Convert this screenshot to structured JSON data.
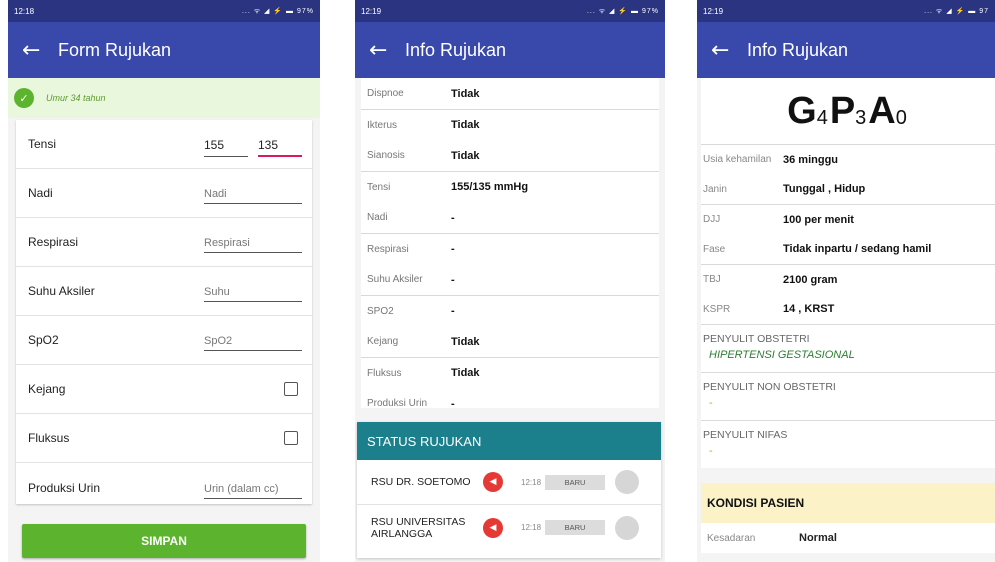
{
  "screen1": {
    "status_time": "12:18",
    "status_icons": "... ᯤ ◢ ⚡ ▬ 97%",
    "title": "Form Rujukan",
    "alert_text": "Umur 34 tahun",
    "fields": [
      {
        "label": "Tensi",
        "type": "pair",
        "value1": "155",
        "value2": "135"
      },
      {
        "label": "Nadi",
        "type": "text",
        "placeholder": "Nadi"
      },
      {
        "label": "Respirasi",
        "type": "text",
        "placeholder": "Respirasi"
      },
      {
        "label": "Suhu Aksiler",
        "type": "text",
        "placeholder": "Suhu"
      },
      {
        "label": "SpO2",
        "type": "text",
        "placeholder": "SpO2"
      },
      {
        "label": "Kejang",
        "type": "check"
      },
      {
        "label": "Fluksus",
        "type": "check"
      },
      {
        "label": "Produksi Urin",
        "type": "text",
        "placeholder": "Urin (dalam cc)"
      }
    ],
    "save_label": "SIMPAN"
  },
  "screen2": {
    "status_time": "12:19",
    "status_icons": "... ᯤ ◢ ⚡ ▬ 97%",
    "title": "Info Rujukan",
    "rows": [
      {
        "label": "Dispnoe",
        "value": "Tidak",
        "sep": false
      },
      {
        "label": "Ikterus",
        "value": "Tidak",
        "sep": true
      },
      {
        "label": "Sianosis",
        "value": "Tidak",
        "sep": false
      },
      {
        "label": "Tensi",
        "value": "155/135 mmHg",
        "sep": true
      },
      {
        "label": "Nadi",
        "value": "-",
        "sep": false
      },
      {
        "label": "Respirasi",
        "value": "-",
        "sep": true
      },
      {
        "label": "Suhu Aksiler",
        "value": "-",
        "sep": false
      },
      {
        "label": "SPO2",
        "value": "-",
        "sep": true
      },
      {
        "label": "Kejang",
        "value": "Tidak",
        "sep": false
      },
      {
        "label": "Fluksus",
        "value": "Tidak",
        "sep": true
      },
      {
        "label": "Produksi Urin",
        "value": "-",
        "sep": false
      }
    ],
    "status_title": "STATUS RUJUKAN",
    "status_rows": [
      {
        "name": "RSU DR. SOETOMO",
        "time": "12:18",
        "badge": "BARU"
      },
      {
        "name": "RSU UNIVERSITAS AIRLANGGA",
        "time": "12:18",
        "badge": "BARU"
      }
    ]
  },
  "screen3": {
    "status_time": "12:19",
    "status_icons": "... ᯤ ◢ ⚡ ▬ 97",
    "title": "Info Rujukan",
    "gpa": {
      "g": "G",
      "g_sub": "4",
      "p": "P",
      "p_sub": "3",
      "a": "A",
      "a_sub": "0"
    },
    "rows": [
      {
        "label": "Usia kehamilan",
        "value": "36 minggu",
        "sep": false
      },
      {
        "label": "Janin",
        "value": "Tunggal , Hidup",
        "sep": false
      },
      {
        "label": "DJJ",
        "value": "100 per menit",
        "sep": true
      },
      {
        "label": "Fase",
        "value": "Tidak inpartu / sedang hamil",
        "sep": false
      },
      {
        "label": "TBJ",
        "value": "2100 gram",
        "sep": true
      },
      {
        "label": "KSPR",
        "value": "14 , KRST",
        "sep": false
      }
    ],
    "blocks": [
      {
        "title": "PENYULIT OBSTETRI",
        "value": "HIPERTENSI GESTASIONAL",
        "kind": "value"
      },
      {
        "title": "PENYULIT NON OBSTETRI",
        "value": "-",
        "kind": "dash"
      },
      {
        "title": "PENYULIT NIFAS",
        "value": "-",
        "kind": "dash"
      }
    ],
    "kondisi_title": "KONDISI PASIEN",
    "kondisi_row": {
      "label": "Kesadaran",
      "value": "Normal"
    }
  }
}
